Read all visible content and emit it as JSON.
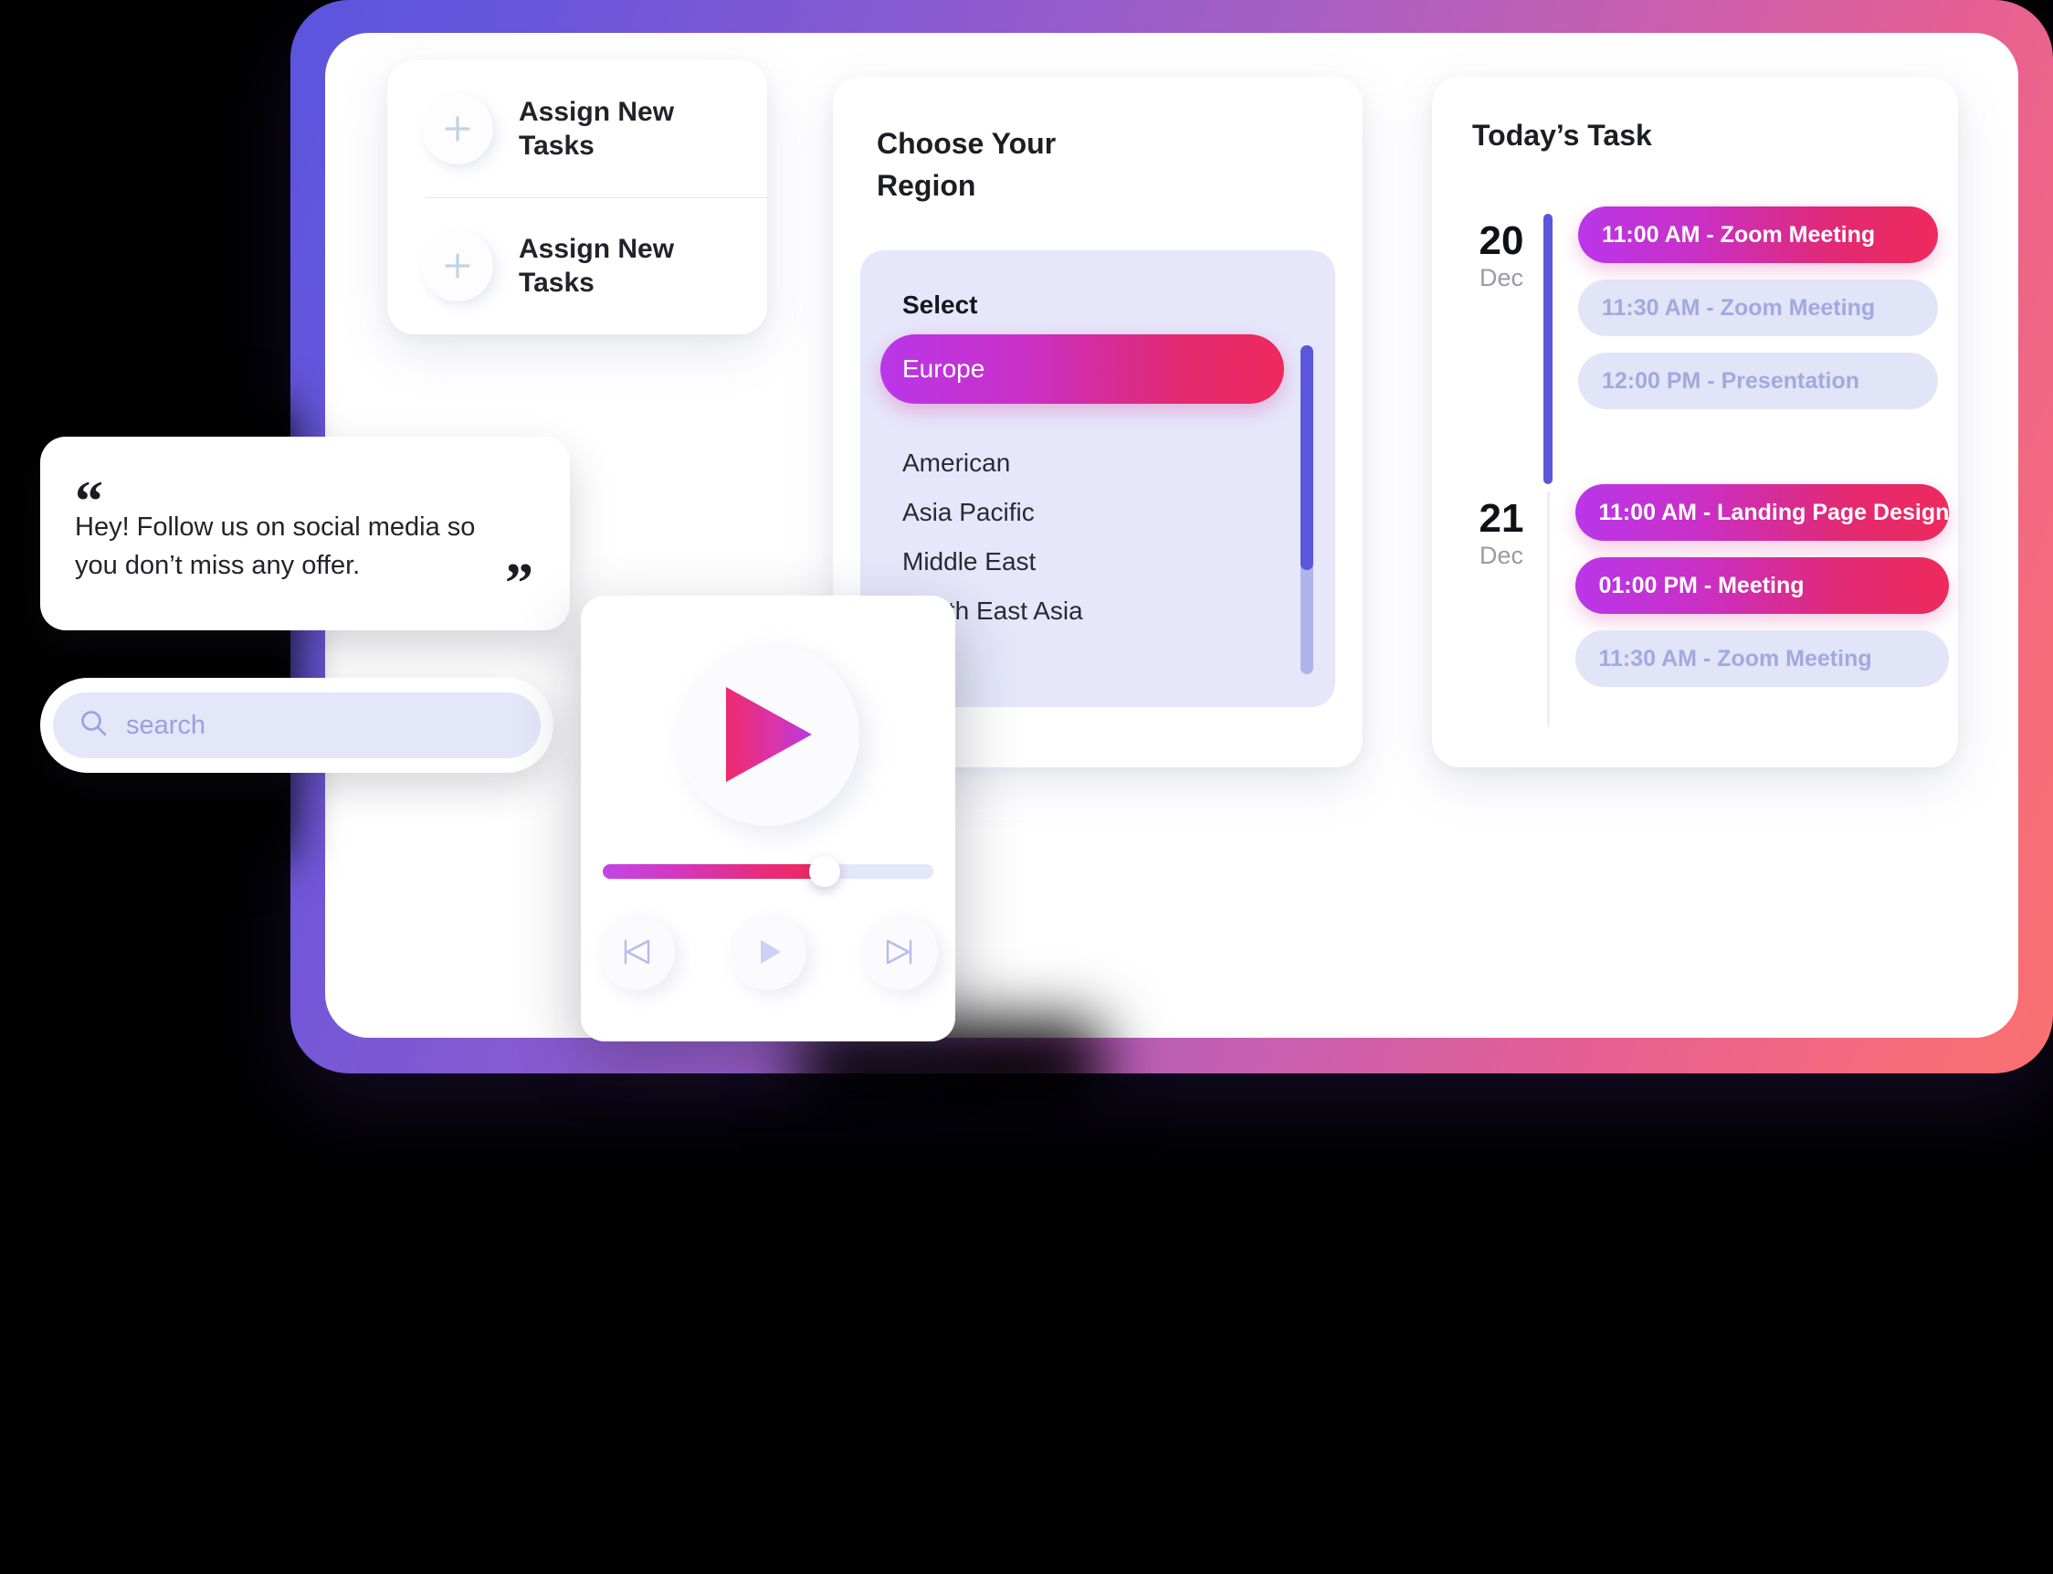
{
  "frame": {
    "gradient_start": "#5B55DE",
    "gradient_mid": "#C55FB2",
    "gradient_end": "#F97070"
  },
  "assign_card": {
    "rows": [
      {
        "icon": "plus-icon",
        "label": "Assign New Tasks"
      },
      {
        "icon": "plus-icon",
        "label": "Assign New Tasks"
      }
    ]
  },
  "region_card": {
    "title": "Choose Your Region",
    "select_label": "Select",
    "selected": "Europe",
    "options": [
      {
        "label": "Europe",
        "selected": true
      },
      {
        "label": "American",
        "selected": false
      },
      {
        "label": "Asia Pacific",
        "selected": false
      },
      {
        "label": "Middle East",
        "selected": false
      },
      {
        "label": "South East Asia",
        "selected": false
      }
    ],
    "accent_gradient_start": "#B936E8",
    "accent_gradient_end": "#EE2A5E",
    "scroll_thumb_color": "#5A57DB",
    "scroll_track_color": "#AEB4EA"
  },
  "task_card": {
    "title": "Today’s Task",
    "groups": [
      {
        "day": "20",
        "month": "Dec",
        "rail": "active",
        "tasks": [
          {
            "label": "11:00 AM - Zoom Meeting",
            "state": "active"
          },
          {
            "label": "11:30 AM - Zoom Meeting",
            "state": "inactive"
          },
          {
            "label": "12:00 PM - Presentation",
            "state": "inactive"
          }
        ]
      },
      {
        "day": "21",
        "month": "Dec",
        "rail": "muted",
        "tasks": [
          {
            "label": "11:00 AM - Landing Page Design",
            "state": "active"
          },
          {
            "label": "01:00 PM - Meeting",
            "state": "active"
          },
          {
            "label": "11:30 AM - Zoom Meeting",
            "state": "inactive"
          }
        ]
      }
    ],
    "active_pill_color": "#EE2A5E",
    "inactive_pill_bg": "#E2E4F7",
    "inactive_pill_text": "#A3A9DE",
    "rail_color": "#5A57DB"
  },
  "quote_card": {
    "open_quote": "“",
    "close_quote": "”",
    "text": "Hey! Follow us on social media so you don’t miss any offer."
  },
  "search": {
    "icon": "search-icon",
    "placeholder": "search",
    "value": ""
  },
  "player": {
    "play_icon": "play-icon",
    "progress_percent": 67,
    "controls": [
      {
        "icon": "skip-previous-icon",
        "name": "previous-button"
      },
      {
        "icon": "play-icon",
        "name": "play-button"
      },
      {
        "icon": "skip-next-icon",
        "name": "next-button"
      }
    ]
  }
}
